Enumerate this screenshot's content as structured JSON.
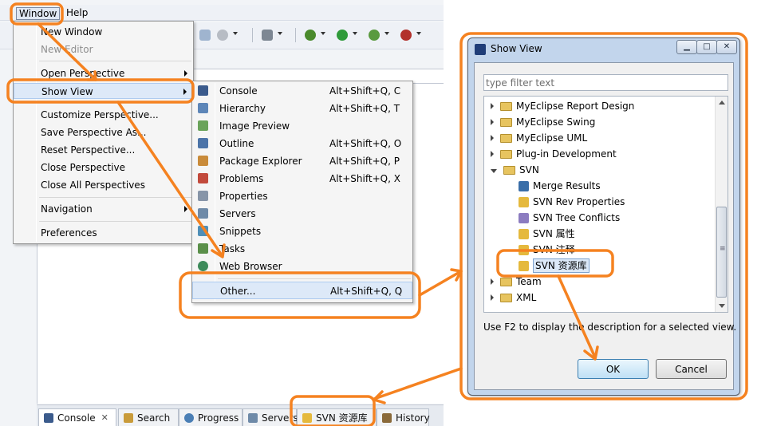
{
  "menubar": {
    "window_label": "Window",
    "help_label": "Help"
  },
  "window_menu": {
    "items": [
      {
        "label": "New Window"
      },
      {
        "label": "New Editor"
      },
      {
        "label": "Open Perspective"
      },
      {
        "label": "Show View"
      },
      {
        "label": "Customize Perspective..."
      },
      {
        "label": "Save Perspective As..."
      },
      {
        "label": "Reset Perspective..."
      },
      {
        "label": "Close Perspective"
      },
      {
        "label": "Close All Perspectives"
      },
      {
        "label": "Navigation"
      },
      {
        "label": "Preferences"
      }
    ]
  },
  "show_view_menu": {
    "items": [
      {
        "label": "Console",
        "shortcut": "Alt+Shift+Q, C",
        "icon": "console-icon"
      },
      {
        "label": "Hierarchy",
        "shortcut": "Alt+Shift+Q, T",
        "icon": "hierarchy-icon"
      },
      {
        "label": "Image Preview",
        "shortcut": "",
        "icon": "image-preview-icon"
      },
      {
        "label": "Outline",
        "shortcut": "Alt+Shift+Q, O",
        "icon": "outline-icon"
      },
      {
        "label": "Package Explorer",
        "shortcut": "Alt+Shift+Q, P",
        "icon": "package-explorer-icon"
      },
      {
        "label": "Problems",
        "shortcut": "Alt+Shift+Q, X",
        "icon": "problems-icon"
      },
      {
        "label": "Properties",
        "shortcut": "",
        "icon": "properties-icon"
      },
      {
        "label": "Servers",
        "shortcut": "",
        "icon": "servers-icon"
      },
      {
        "label": "Snippets",
        "shortcut": "",
        "icon": "snippets-icon"
      },
      {
        "label": "Tasks",
        "shortcut": "",
        "icon": "tasks-icon"
      },
      {
        "label": "Web Browser",
        "shortcut": "",
        "icon": "web-browser-icon"
      }
    ],
    "other": {
      "label": "Other...",
      "shortcut": "Alt+Shift+Q, Q"
    }
  },
  "dialog": {
    "title": "Show View",
    "filter_placeholder": "type filter text",
    "tree": {
      "folders_top": [
        {
          "label": "MyEclipse Report Design"
        },
        {
          "label": "MyEclipse Swing"
        },
        {
          "label": "MyEclipse UML"
        },
        {
          "label": "Plug-in Development"
        }
      ],
      "svn_folder": {
        "label": "SVN"
      },
      "svn_children": [
        {
          "label": "Merge Results"
        },
        {
          "label": "SVN Rev Properties"
        },
        {
          "label": "SVN Tree Conflicts"
        },
        {
          "label": "SVN 属性"
        },
        {
          "label": "SVN 注释"
        },
        {
          "label": "SVN 资源库"
        }
      ],
      "folders_bottom": [
        {
          "label": "Team"
        },
        {
          "label": "XML"
        }
      ]
    },
    "hint": "Use F2 to display the description for a selected view.",
    "ok_label": "OK",
    "cancel_label": "Cancel"
  },
  "bottom_tabs": [
    {
      "label": "Console"
    },
    {
      "label": "Search"
    },
    {
      "label": "Progress"
    },
    {
      "label": "Servers"
    },
    {
      "label": "SVN 资源库"
    },
    {
      "label": "History"
    }
  ],
  "colors": {
    "annotation": "#f58220",
    "selection": "#dce9f8",
    "folder": "#e7c45f"
  }
}
